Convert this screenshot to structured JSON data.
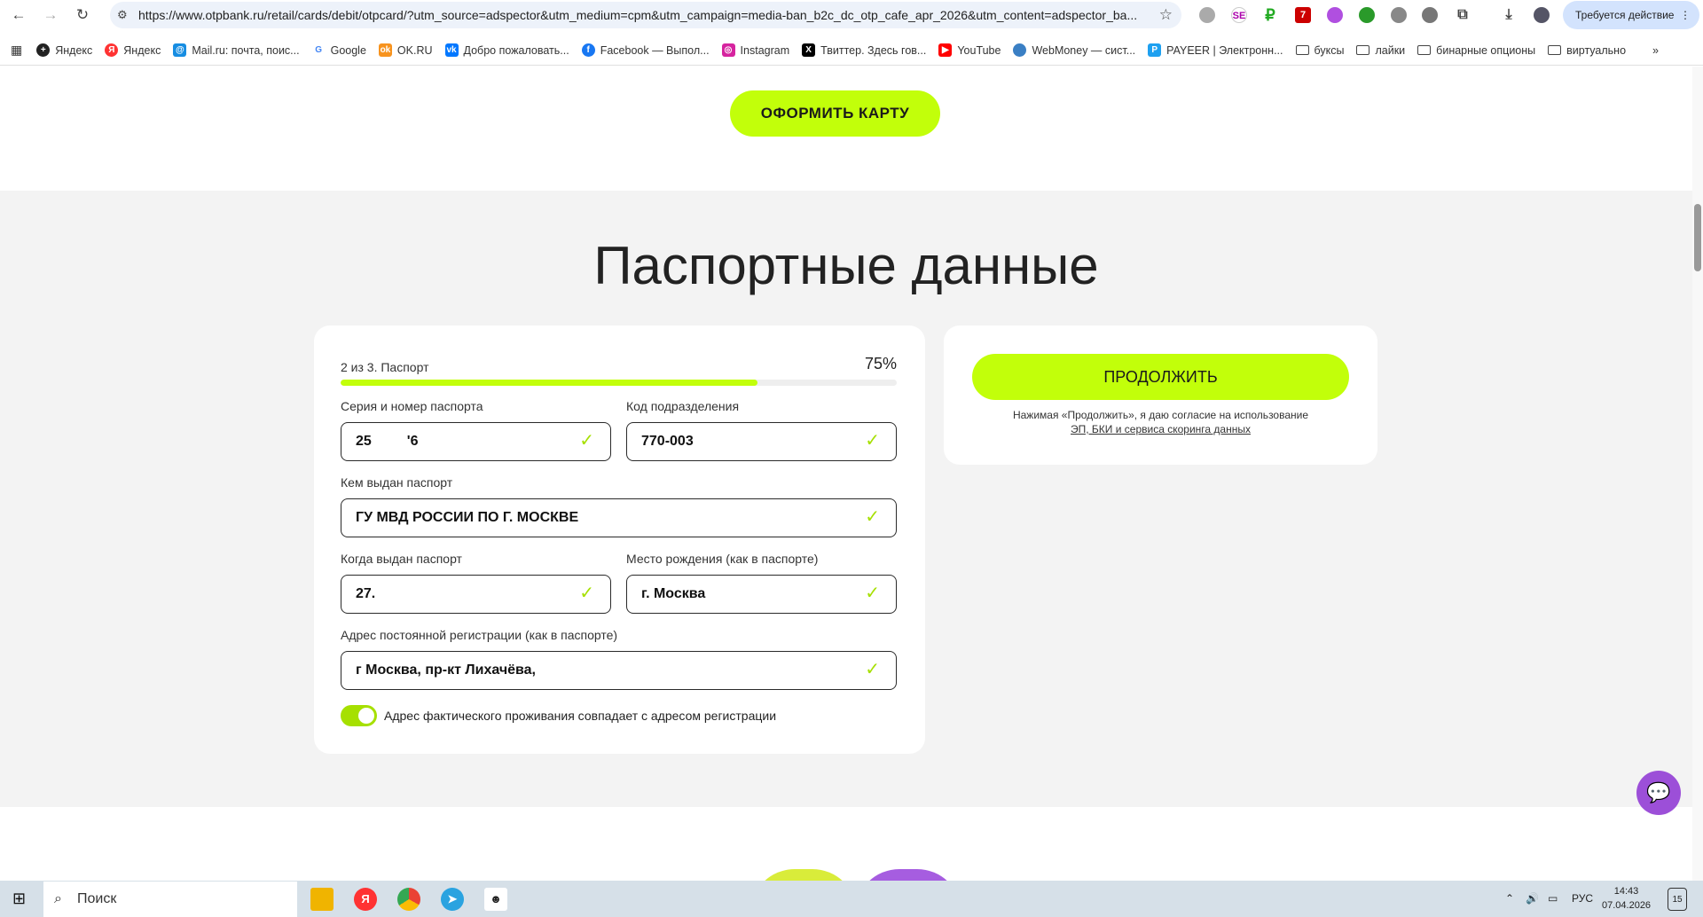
{
  "browser": {
    "url": "https://www.otpbank.ru/retail/cards/debit/otpcard/?utm_source=adspector&utm_medium=cpm&utm_campaign=media-ban_b2c_dc_otp_cafe_apr_2026&utm_content=adspector_ba...",
    "action_button": "Требуется действие",
    "bookmarks": [
      "Яндекс",
      "Яндекс",
      "Mail.ru: почта, поис...",
      "Google",
      "OK.RU",
      "Добро пожаловать...",
      "Facebook — Выпол...",
      "Instagram",
      "Твиттер. Здесь гов...",
      "YouTube",
      "WebMoney — сист...",
      "PAYEER | Электронн..."
    ],
    "folders": [
      "буксы",
      "лайки",
      "бинарные опционы",
      "виртуально"
    ],
    "extension_badge": "7"
  },
  "page": {
    "order_button": "ОФОРМИТЬ КАРТУ",
    "title": "Паспортные данные",
    "progress": {
      "label": "2 из 3. Паспорт",
      "percent_text": "75%",
      "value": 75
    },
    "fields": {
      "passport_number": {
        "label": "Серия и номер паспорта",
        "value": "25         '6"
      },
      "division_code": {
        "label": "Код подразделения",
        "value": "770-003"
      },
      "issued_by": {
        "label": "Кем выдан паспорт",
        "value": "ГУ МВД РОССИИ ПО Г. МОСКВЕ"
      },
      "issue_date": {
        "label": "Когда выдан паспорт",
        "value": "27."
      },
      "birth_place": {
        "label": "Место рождения (как в паспорте)",
        "value": "г. Москва"
      },
      "address": {
        "label": "Адрес постоянной регистрации (как в паспорте)",
        "value": "г Москва, пр-кт Лихачёва,"
      }
    },
    "same_address_toggle": {
      "label": "Адрес фактического проживания совпадает с адресом регистрации",
      "on": true
    },
    "continue_button": "ПРОДОЛЖИТЬ",
    "consent_text": "Нажимая «Продолжить», я даю согласие на использование",
    "consent_link": "ЭП, БКИ и сервиса скоринга данных"
  },
  "taskbar": {
    "search_placeholder": "Поиск",
    "lang": "РУС",
    "time": "14:43",
    "date": "07.04.2026",
    "notifications": "15"
  },
  "colors": {
    "accent": "#c2ff0a",
    "check": "#a6e000",
    "chat": "#9c4fd8"
  }
}
